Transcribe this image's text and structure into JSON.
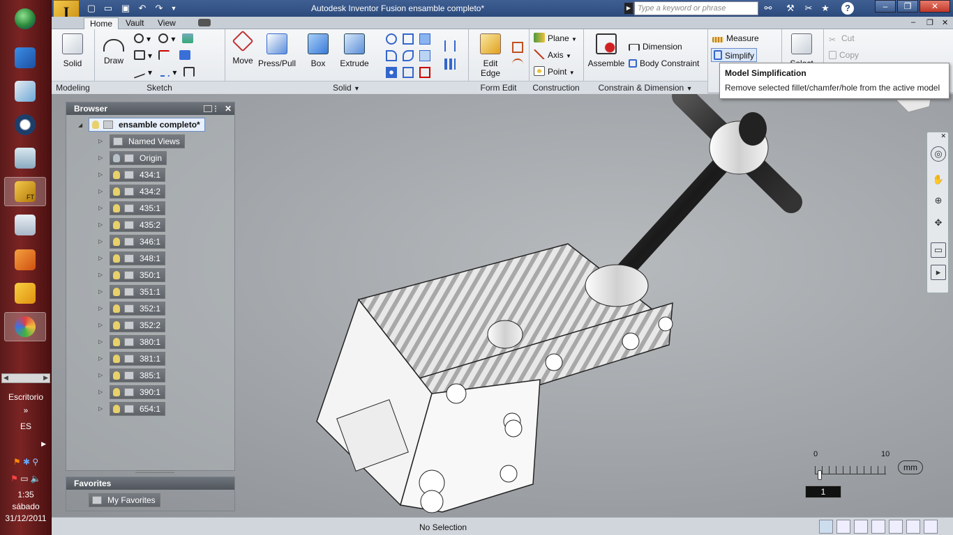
{
  "window": {
    "title": "Autodesk Inventor Fusion   ensamble completo*",
    "search_placeholder": "Type a keyword or phrase",
    "logo": "I"
  },
  "tabs": [
    "Home",
    "Vault",
    "View"
  ],
  "ribbon": {
    "modeling": {
      "solid": "Solid",
      "label": "Modeling"
    },
    "sketch": {
      "draw": "Draw",
      "label": "Sketch"
    },
    "solid": {
      "move": "Move",
      "press_pull": "Press/Pull",
      "box": "Box",
      "extrude": "Extrude",
      "label": "Solid"
    },
    "form_edit": {
      "edit_edge": "Edit Edge",
      "label": "Form Edit"
    },
    "construction": {
      "plane": "Plane",
      "axis": "Axis",
      "point": "Point",
      "label": "Construction"
    },
    "constrain": {
      "assemble": "Assemble",
      "dimension": "Dimension",
      "body_constraint": "Body Constraint",
      "label": "Constrain & Dimension"
    },
    "measure": {
      "measure": "Measure",
      "simplify": "Simplify"
    },
    "clipboard": {
      "cut": "Cut",
      "copy": "Copy",
      "select": "Select"
    }
  },
  "tooltip": {
    "title": "Model Simplification",
    "desc": "Remove selected fillet/chamfer/hole from the active model"
  },
  "browser": {
    "title": "Browser",
    "root": "ensamble completo*",
    "items": [
      "Named Views",
      "Origin",
      "434:1",
      "434:2",
      "435:1",
      "435:2",
      "346:1",
      "348:1",
      "350:1",
      "351:1",
      "352:1",
      "352:2",
      "380:1",
      "381:1",
      "385:1",
      "390:1",
      "654:1"
    ]
  },
  "favorites": {
    "title": "Favorites",
    "item": "My Favorites"
  },
  "scale": {
    "zero": "0",
    "ten": "10",
    "unit": "mm",
    "value": "1"
  },
  "status": {
    "text": "No Selection"
  },
  "taskbar": {
    "desktop": "Escritorio",
    "lang": "ES",
    "time": "1:35",
    "day": "sábado",
    "date": "31/12/2011",
    "tag": "FT"
  },
  "colors": {
    "title_bg": "#2c4a7c",
    "ribbon_bg": "#e4e8ec",
    "viewport_bg": "#a2a6aa",
    "taskbar_bg": "#6a1e1e",
    "accent": "#6a8cc8"
  }
}
